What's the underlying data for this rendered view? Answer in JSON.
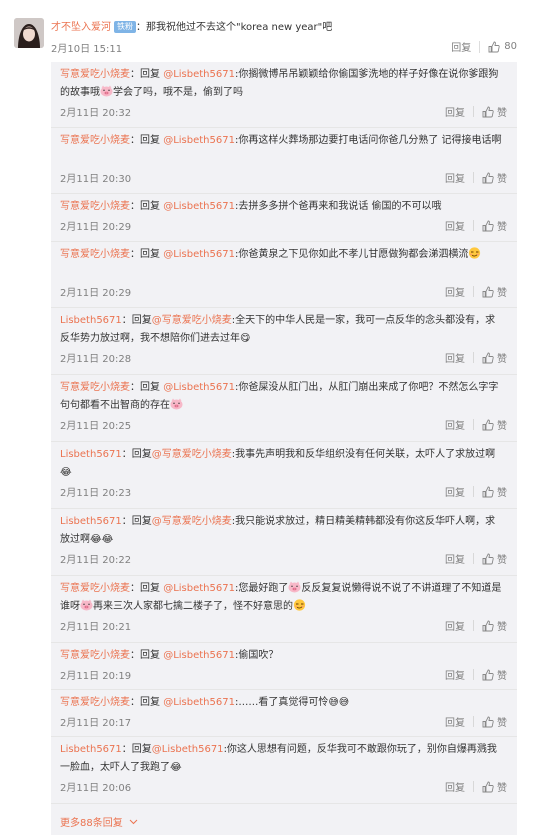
{
  "top_comment": {
    "username": "才不坠入爱河",
    "badge": "铁粉",
    "text": "：那我祝他过不去这个\"korea new year\"吧",
    "time": "2月10日 15:11",
    "reply_label": "回复",
    "like_count": "80"
  },
  "reply_label": "回复",
  "like_label": "赞",
  "replies": [
    {
      "user": "写意爱吃小烧麦",
      "mid": "：回复 ",
      "target": "@Lisbeth5671",
      "text1": ":你搁微博吊吊颖颖给你偷国爹洗地的样子好像在说你爹跟狗的故事哦",
      "emoji": "pig",
      "text2": "学会了吗，哦不是，偷到了吗",
      "time": "2月11日 20:32"
    },
    {
      "user": "写意爱吃小烧麦",
      "mid": "：回复 ",
      "target": "@Lisbeth5671",
      "text1": ":你再这样火葬场那边要打电话问你爸几分熟了 记得接电话啊",
      "time": "2月11日 20:30"
    },
    {
      "user": "写意爱吃小烧麦",
      "mid": "：回复 ",
      "target": "@Lisbeth5671",
      "text1": ":去拼多多拼个爸再来和我说话 偷国的不可以哦",
      "time": "2月11日 20:29"
    },
    {
      "user": "写意爱吃小烧麦",
      "mid": "：回复 ",
      "target": "@Lisbeth5671",
      "text1": ":你爸黄泉之下见你如此不孝儿甘愿做狗都会涕泗横流",
      "emoji": "smirk",
      "time": "2月11日 20:29"
    },
    {
      "user": "Lisbeth5671",
      "mid": "：回复",
      "target": "@写意爱吃小烧麦",
      "text1": ":全天下的中华人民是一家，我可一点反华的念头都没有，求反华势力放过啊，我不想陪你们进去过年😋",
      "time": "2月11日 20:28"
    },
    {
      "user": "写意爱吃小烧麦",
      "mid": "：回复 ",
      "target": "@Lisbeth5671",
      "text1": ":你爸屎没从肛门出，从肛门崩出来成了你吧？不然怎么字字句句都看不出智商的存在",
      "emoji": "pig",
      "time": "2月11日 20:25"
    },
    {
      "user": "Lisbeth5671",
      "mid": "：回复",
      "target": "@写意爱吃小烧麦",
      "text1": ":我事先声明我和反华组织没有任何关联，太吓人了求放过啊😂",
      "time": "2月11日 20:23"
    },
    {
      "user": "Lisbeth5671",
      "mid": "：回复",
      "target": "@写意爱吃小烧麦",
      "text1": ":我只能说求放过，精日精美精韩都没有你这反华吓人啊，求放过啊😂😂",
      "time": "2月11日 20:22"
    },
    {
      "user": "写意爱吃小烧麦",
      "mid": "：回复 ",
      "target": "@Lisbeth5671",
      "text1": ":您最好跑了",
      "emoji": "pig",
      "text2": "反反复复说懒得说不说了不讲道理了不知道是谁呀",
      "emoji2": "pig",
      "text3": "再来三次人家都七擒二楼子了，怪不好意思的",
      "emoji3": "smirk",
      "time": "2月11日 20:21"
    },
    {
      "user": "写意爱吃小烧麦",
      "mid": "：回复 ",
      "target": "@Lisbeth5671",
      "text1": ":偷国吹？",
      "time": "2月11日 20:19"
    },
    {
      "user": "写意爱吃小烧麦",
      "mid": "：回复 ",
      "target": "@Lisbeth5671",
      "text1": ":……看了真觉得可怜😅😅",
      "time": "2月11日 20:17"
    },
    {
      "user": "Lisbeth5671",
      "mid": "：回复",
      "target": "@Lisbeth5671",
      "text1": ":你这人思想有问题，反华我可不敢跟你玩了，别你自爆再溅我一脸血，太吓人了我跑了😂",
      "time": "2月11日 20:06"
    }
  ],
  "more_replies": "更多88条回复"
}
